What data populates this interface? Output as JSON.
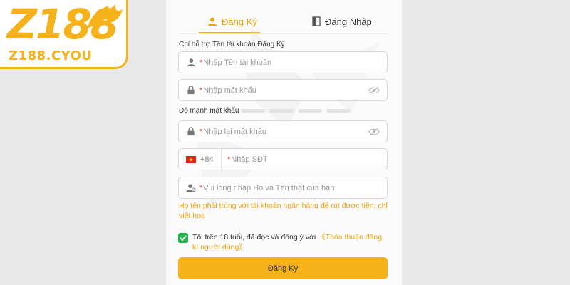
{
  "logo": {
    "main": "Z188",
    "domain": "Z188.CYOU"
  },
  "tabs": [
    {
      "label": "Đăng Ký",
      "active": true,
      "icon": "user-icon"
    },
    {
      "label": "Đăng Nhập",
      "active": false,
      "icon": "login-door-icon"
    }
  ],
  "form": {
    "username_label": "Chỉ hỗ trợ Tên tài khoản Đăng Ký",
    "username_placeholder": "Nhập Tên tài khoản",
    "password_placeholder": "Nhập mật khẩu",
    "strength_label": "Độ mạnh mật khẩu",
    "confirm_placeholder": "Nhập lại mật khẩu",
    "phone_code": "+84",
    "phone_placeholder": "Nhập SĐT",
    "fullname_placeholder": "Vui lòng nhập Họ và Tên thật của bạn",
    "required_mark": "*",
    "fullname_warning": "Họ tên phải trùng với tài khoản ngân hàng để rút được tiền, chỉ viết hoa",
    "agree_text": "Tôi trên 18 tuổi, đã đọc và đồng ý với",
    "agree_link": "《Thỏa thuận đăng kí người dùng》",
    "agree_checked": true,
    "submit_label": "Đăng Ký"
  },
  "colors": {
    "accent": "#f5b21a",
    "check": "#23b14d",
    "warning": "#f0a400"
  }
}
